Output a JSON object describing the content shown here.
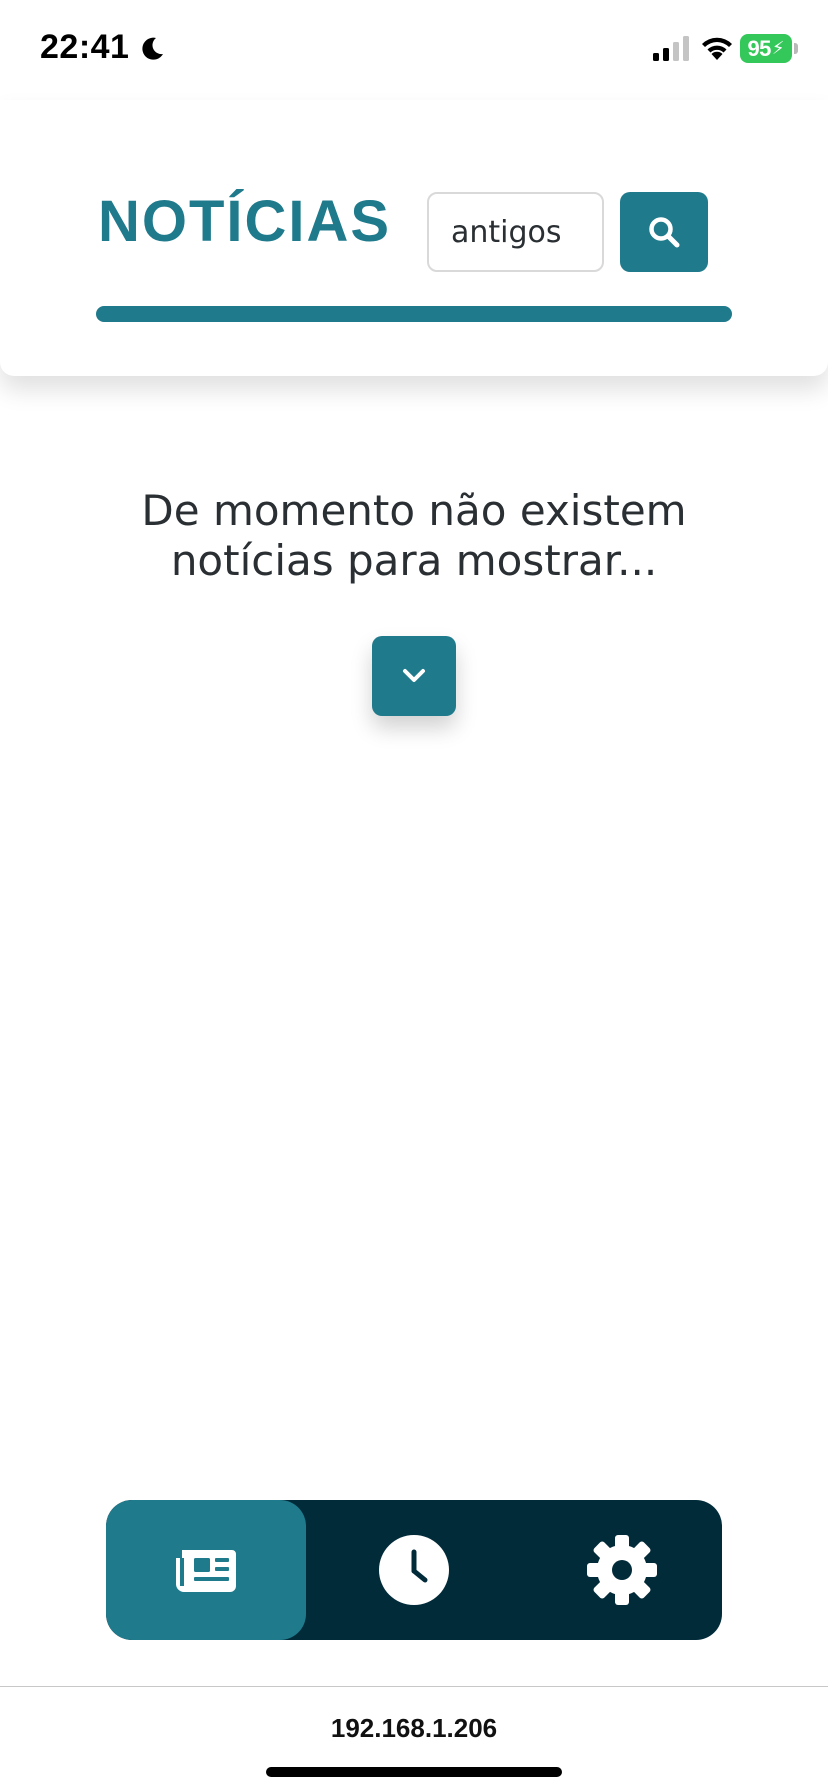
{
  "status_bar": {
    "time": "22:41",
    "battery": "95",
    "icons": [
      "moon-icon",
      "signal-icon",
      "wifi-icon",
      "battery-icon"
    ]
  },
  "header": {
    "title": "NOTÍCIAS",
    "search_value": "antigos",
    "search_icon": "search-icon",
    "accent_color": "#1f7a8c"
  },
  "main": {
    "empty_message": "De momento não existem notícias para mostrar...",
    "expand_icon": "chevron-down-icon"
  },
  "bottom_nav": {
    "background_color": "#022b3a",
    "active_color": "#1f7a8c",
    "tabs": [
      {
        "icon": "newspaper-icon",
        "active": true
      },
      {
        "icon": "clock-icon",
        "active": false
      },
      {
        "icon": "gear-icon",
        "active": false
      }
    ]
  },
  "browser": {
    "address": "192.168.1.206"
  },
  "colors": {
    "battery": "#34c759"
  }
}
